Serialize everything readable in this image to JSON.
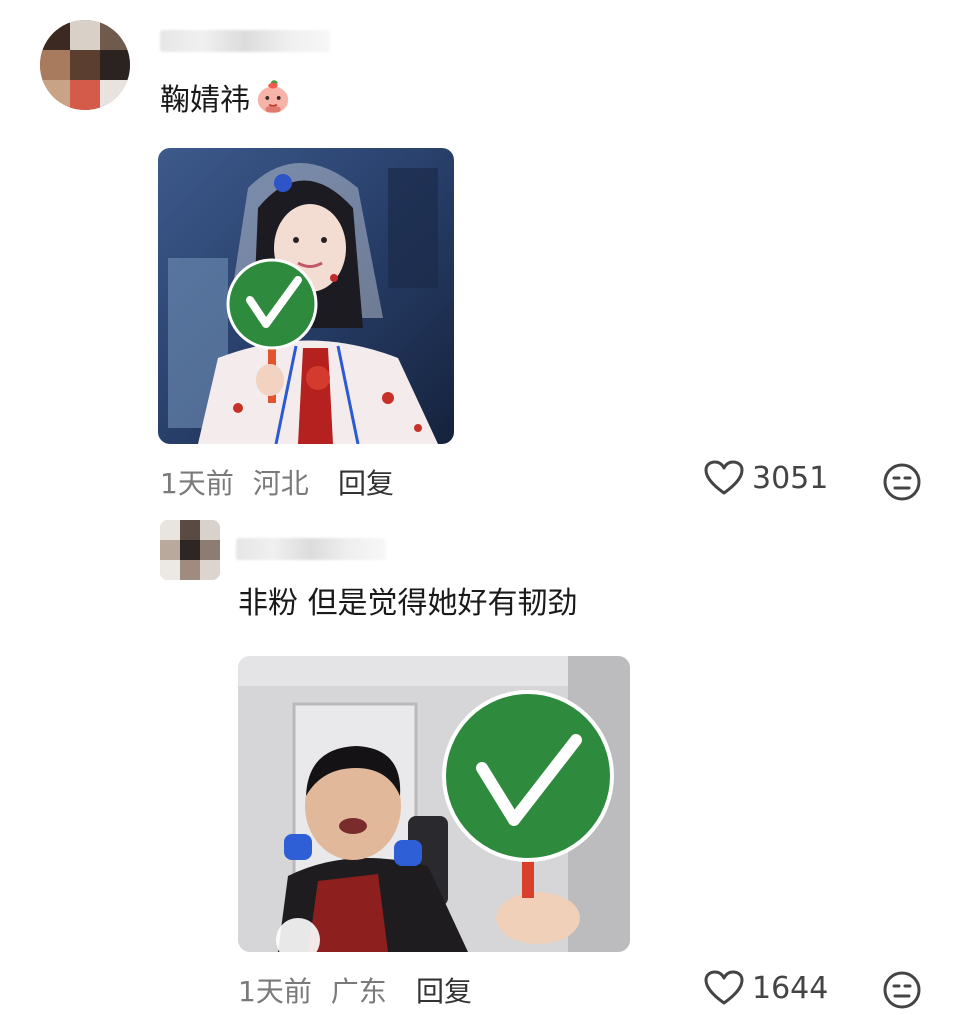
{
  "comments": [
    {
      "text": "鞠婧祎",
      "sticker": "peach-face-sticker",
      "image": "girl-holding-checkmark-sign",
      "time": "1天前",
      "location": "河北",
      "reply_label": "回复",
      "likes": "3051"
    },
    {
      "text": "非粉 但是觉得她好有韧劲",
      "image": "boy-holding-checkmark-sign",
      "time": "1天前",
      "location": "广东",
      "reply_label": "回复",
      "likes": "1644"
    }
  ],
  "icons": {
    "like": "heart-outline-icon",
    "dislike": "neutral-face-icon"
  },
  "colors": {
    "check_green": "#2e8b3d",
    "meta_gray": "#7a7a7a"
  }
}
